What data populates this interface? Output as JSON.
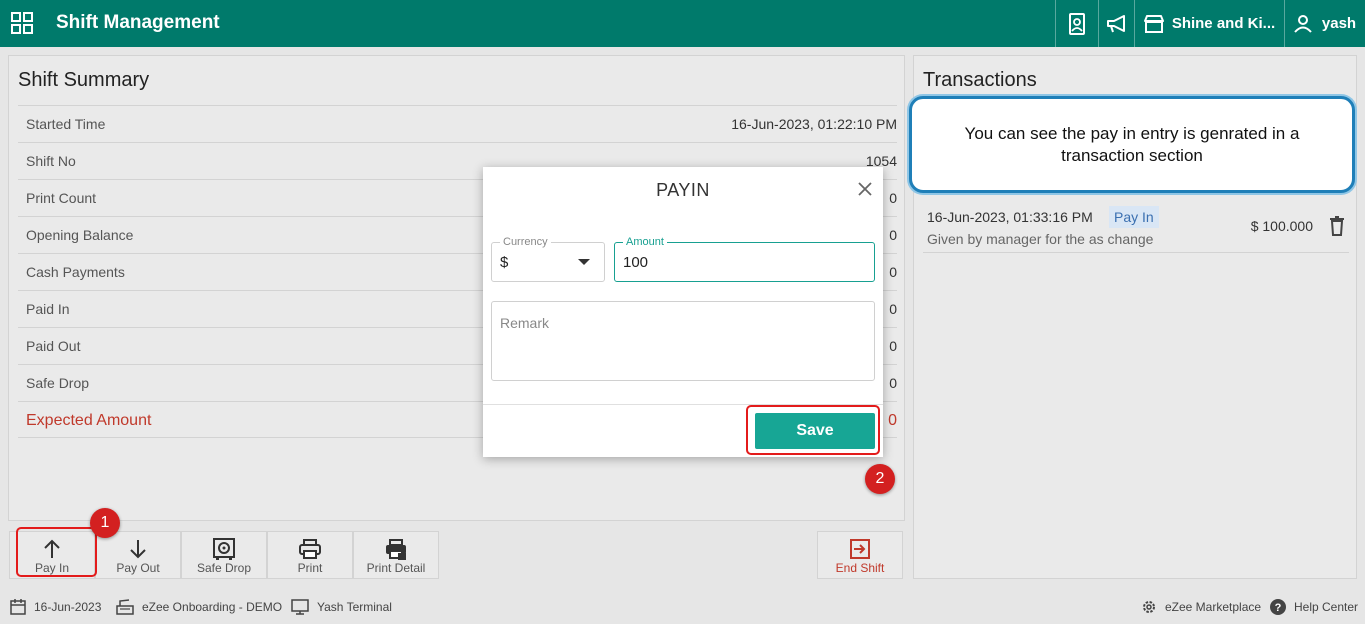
{
  "header": {
    "title": "Shift Management",
    "store_name": "Shine and Ki...",
    "user_name": "yash"
  },
  "summary": {
    "title": "Shift Summary",
    "rows": [
      {
        "label": "Started Time",
        "value": "16-Jun-2023, 01:22:10 PM"
      },
      {
        "label": "Shift No",
        "value": "1054"
      },
      {
        "label": "Print Count",
        "value": "0"
      },
      {
        "label": "Opening Balance",
        "value": "0"
      },
      {
        "label": "Cash Payments",
        "value": "0"
      },
      {
        "label": "Paid In",
        "value": "0"
      },
      {
        "label": "Paid Out",
        "value": "0"
      },
      {
        "label": "Safe Drop",
        "value": "0"
      },
      {
        "label": "Expected Amount",
        "value": "0"
      }
    ]
  },
  "transactions": {
    "title": "Transactions",
    "items": [
      {
        "datetime": "16-Jun-2023, 01:33:16 PM",
        "type": "Pay In",
        "remark": "Given by manager for the as change",
        "amount": "$ 100.000"
      }
    ]
  },
  "toolbar": {
    "pay_in": "Pay In",
    "pay_out": "Pay Out",
    "safe_drop": "Safe Drop",
    "print": "Print",
    "print_detail": "Print Detail",
    "end_shift": "End Shift"
  },
  "statusbar": {
    "date": "16-Jun-2023",
    "org": "eZee Onboarding - DEMO",
    "terminal": "Yash Terminal",
    "marketplace": "eZee Marketplace",
    "help": "Help Center"
  },
  "modal": {
    "title": "PAYIN",
    "currency_label": "Currency",
    "currency_value": "$",
    "amount_label": "Amount",
    "amount_value": "100",
    "remark_placeholder": "Remark",
    "save_label": "Save"
  },
  "annotations": {
    "step1": "1",
    "step2": "2",
    "callout": "You can see the pay in entry is genrated in a transaction section",
    "highlight_color": "#e31b1b"
  },
  "colors": {
    "brand": "#007a6b",
    "accent": "#17a695",
    "danger": "#c0392b"
  }
}
